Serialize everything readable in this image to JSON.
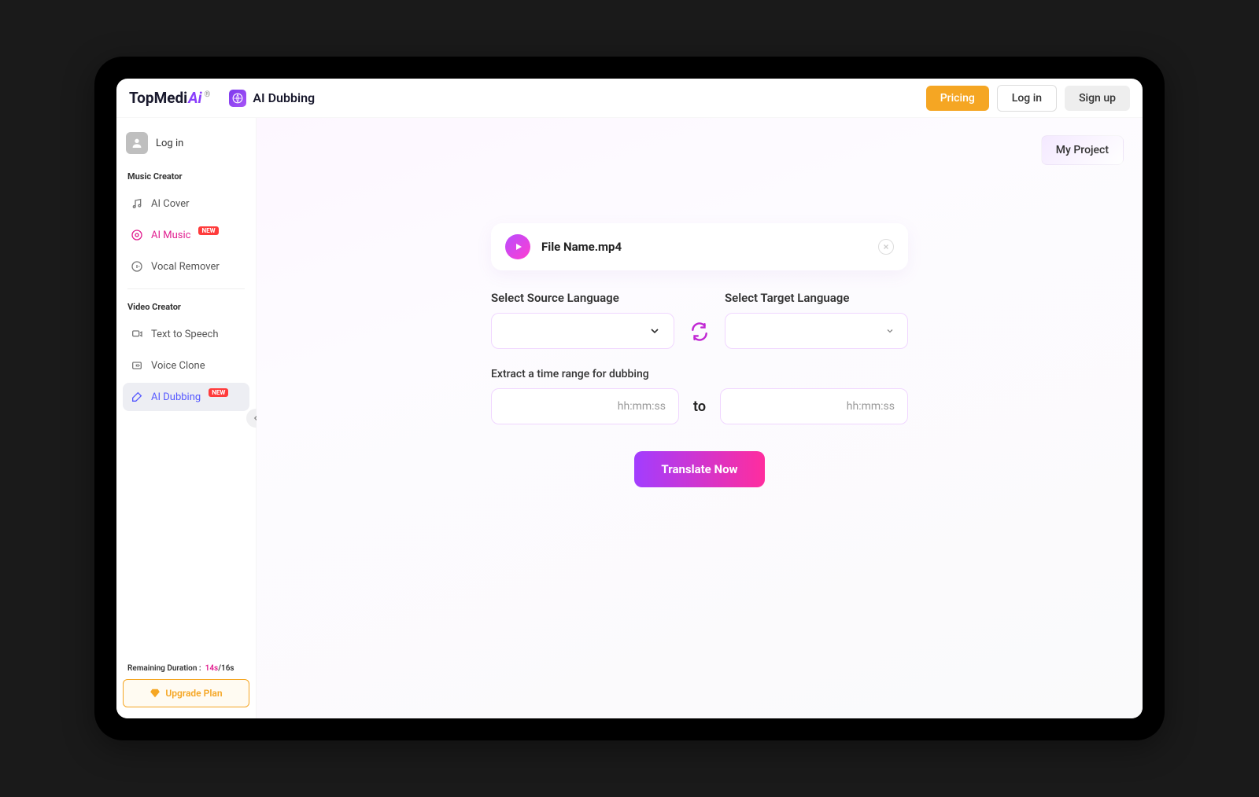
{
  "brand": {
    "name": "TopMedi",
    "suffix": "Ai",
    "reg": "®"
  },
  "app": {
    "title": "AI Dubbing"
  },
  "topbar": {
    "pricing": "Pricing",
    "login": "Log in",
    "signup": "Sign up"
  },
  "sidebar": {
    "login": "Log in",
    "sections": {
      "music": "Music Creator",
      "video": "Video Creator"
    },
    "items": {
      "ai_cover": "AI Cover",
      "ai_music": "AI Music",
      "vocal_remover": "Vocal Remover",
      "tts": "Text to Speech",
      "voice_clone": "Voice Clone",
      "ai_dubbing": "AI Dubbing"
    },
    "new_badge": "NEW",
    "remaining_label": "Remaining Duration :",
    "remaining_used": "14s",
    "remaining_total": "/16s",
    "upgrade": "Upgrade Plan"
  },
  "main": {
    "my_project": "My Project",
    "file_name": "File Name.mp4",
    "source_label": "Select  Source Language",
    "target_label": "Select  Target Language",
    "time_label": "Extract a time range for dubbing",
    "time_placeholder": "hh:mm:ss",
    "to": "to",
    "translate": "Translate Now"
  }
}
